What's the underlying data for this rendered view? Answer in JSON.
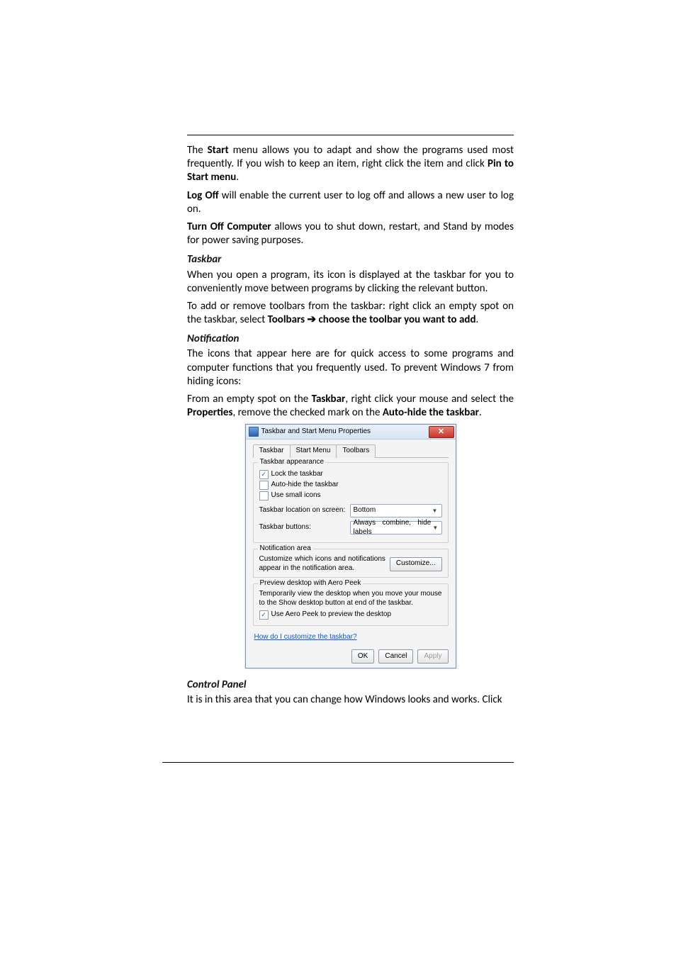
{
  "doc": {
    "p1": {
      "t1": "The ",
      "b1": "Start",
      "t2": " menu allows you to adapt and show the programs used most frequently. If you wish to keep an item, right click the item and click ",
      "b2": "Pin to Start menu",
      "t3": "."
    },
    "p2": {
      "b1": "Log Off",
      "t1": " will enable the current user to log off and allows a new user to log on."
    },
    "p3": {
      "b1": "Turn Off Computer",
      "t1": " allows you to shut down, restart, and Stand by modes for power saving purposes."
    },
    "h_taskbar": "Taskbar",
    "p4": "When you open a program, its icon is displayed at the taskbar for you to conveniently move between programs by clicking the relevant button.",
    "p5": {
      "t1": "To add or remove toolbars from the taskbar: right click an empty spot on the taskbar, select ",
      "b1": "Toolbars ",
      "arrow": "➔",
      "b2": " choose the toolbar you want to add",
      "t2": "."
    },
    "h_notification": "Notification",
    "p6": "The icons that appear here are for quick access to some programs and computer functions that you frequently used. To prevent Windows 7 from hiding icons:",
    "p7": {
      "t1": "From an empty spot on the ",
      "b1": "Taskbar",
      "t2": ", right click your mouse and select the ",
      "b2": "Properties",
      "t3": ", remove the checked mark on the ",
      "b3": "Auto-hide the taskbar",
      "t4": "."
    },
    "h_control_panel": "Control Panel",
    "p8": "It is in this area that you can change how Windows looks and works. Click"
  },
  "dlg": {
    "title": "Taskbar and Start Menu Properties",
    "close_glyph": "✕",
    "tabs": {
      "taskbar": "Taskbar",
      "startmenu": "Start Menu",
      "toolbars": "Toolbars"
    },
    "grp_appearance": "Taskbar appearance",
    "chk_lock": "Lock the taskbar",
    "chk_autohide": "Auto-hide the taskbar",
    "chk_smallicons": "Use small icons",
    "lbl_location": "Taskbar location on screen:",
    "val_location": "Bottom",
    "lbl_buttons": "Taskbar buttons:",
    "val_buttons": "Always combine, hide labels",
    "grp_notification": "Notification area",
    "txt_notification": "Customize which icons and notifications appear in the notification area.",
    "btn_customize": "Customize...",
    "grp_aero": "Preview desktop with Aero Peek",
    "txt_aero": "Temporarily view the desktop when you move your mouse to the Show desktop button at end of the taskbar.",
    "chk_aero": "Use Aero Peek to preview the desktop",
    "link_help": "How do I customize the taskbar?",
    "btn_ok": "OK",
    "btn_cancel": "Cancel",
    "btn_apply": "Apply",
    "chevron": "▼",
    "check_glyph": "✓"
  }
}
